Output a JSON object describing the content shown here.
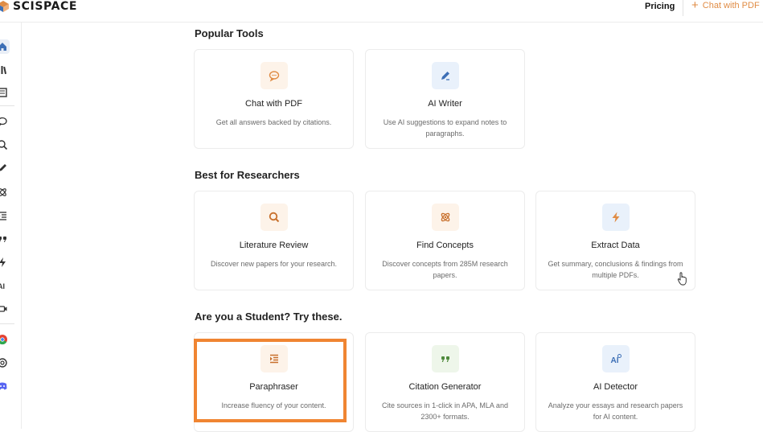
{
  "header": {
    "brand": "SCISPACE",
    "pricing_label": "Pricing",
    "chat_pdf_label": "Chat with PDF",
    "plus_icon": "+"
  },
  "sidebar": {
    "items": [
      {
        "name": "home-icon",
        "active": true
      },
      {
        "name": "library-icon"
      },
      {
        "name": "notebook-icon"
      },
      {
        "name": "chat-icon"
      },
      {
        "name": "search-icon"
      },
      {
        "name": "pen-icon"
      },
      {
        "name": "concepts-icon"
      },
      {
        "name": "paraphrase-icon"
      },
      {
        "name": "quote-icon"
      },
      {
        "name": "bolt-icon"
      },
      {
        "name": "ai-detector-icon"
      },
      {
        "name": "video-icon"
      },
      {
        "name": "chrome-icon"
      },
      {
        "name": "openai-icon"
      },
      {
        "name": "discord-icon"
      }
    ]
  },
  "sections": [
    {
      "title": "Popular Tools",
      "cards": [
        {
          "title": "Chat with PDF",
          "desc": "Get all answers backed by citations.",
          "icon": "chat-bubble-icon",
          "color": "#e08c45"
        },
        {
          "title": "AI Writer",
          "desc": "Use AI suggestions to expand notes to paragraphs.",
          "icon": "pen-icon",
          "color": "#3d6fb6"
        }
      ]
    },
    {
      "title": "Best for Researchers",
      "cards": [
        {
          "title": "Literature Review",
          "desc": "Discover new papers for your research.",
          "icon": "magnifier-icon",
          "color": "#c8702c"
        },
        {
          "title": "Find Concepts",
          "desc": "Discover concepts from 285M research papers.",
          "icon": "atom-icon",
          "color": "#c8702c"
        },
        {
          "title": "Extract Data",
          "desc": "Get summary, conclusions & findings from multiple PDFs.",
          "icon": "bolt-icon",
          "color": "#e08c45"
        }
      ]
    },
    {
      "title": "Are you a Student? Try these.",
      "cards": [
        {
          "title": "Paraphraser",
          "desc": "Increase fluency of your content.",
          "icon": "paraphrase-icon",
          "color": "#c8702c"
        },
        {
          "title": "Citation Generator",
          "desc": "Cite sources in 1-click in APA, MLA and 2300+ formats.",
          "icon": "quote-icon",
          "color": "#4f8a3c"
        },
        {
          "title": "AI Detector",
          "desc": "Analyze your essays and research papers for AI content.",
          "icon": "ai-detector-icon",
          "color": "#3d6fb6"
        }
      ]
    }
  ],
  "colors": {
    "accent": "#e08c45",
    "highlight_border": "#f08532"
  }
}
